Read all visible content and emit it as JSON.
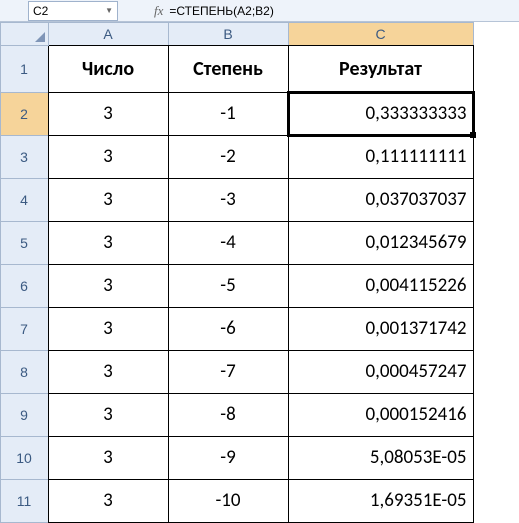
{
  "namebox": {
    "cell": "C2"
  },
  "formula_bar": {
    "fx_label": "fx",
    "formula": "=СТЕПЕНЬ(A2;B2)"
  },
  "columns": [
    "A",
    "B",
    "C"
  ],
  "row_labels": [
    "1",
    "2",
    "3",
    "4",
    "5",
    "6",
    "7",
    "8",
    "9",
    "10",
    "11"
  ],
  "headers": {
    "A": "Число",
    "B": "Степень",
    "C": "Результат"
  },
  "active": {
    "col_index": 2,
    "row_index": 1
  },
  "chart_data": {
    "type": "table",
    "columns": [
      "Число",
      "Степень",
      "Результат"
    ],
    "rows": [
      {
        "A": "3",
        "B": "-1",
        "C": "0,333333333"
      },
      {
        "A": "3",
        "B": "-2",
        "C": "0,111111111"
      },
      {
        "A": "3",
        "B": "-3",
        "C": "0,037037037"
      },
      {
        "A": "3",
        "B": "-4",
        "C": "0,012345679"
      },
      {
        "A": "3",
        "B": "-5",
        "C": "0,004115226"
      },
      {
        "A": "3",
        "B": "-6",
        "C": "0,001371742"
      },
      {
        "A": "3",
        "B": "-7",
        "C": "0,000457247"
      },
      {
        "A": "3",
        "B": "-8",
        "C": "0,000152416"
      },
      {
        "A": "3",
        "B": "-9",
        "C": "5,08053E-05"
      },
      {
        "A": "3",
        "B": "-10",
        "C": "1,69351E-05"
      }
    ]
  }
}
